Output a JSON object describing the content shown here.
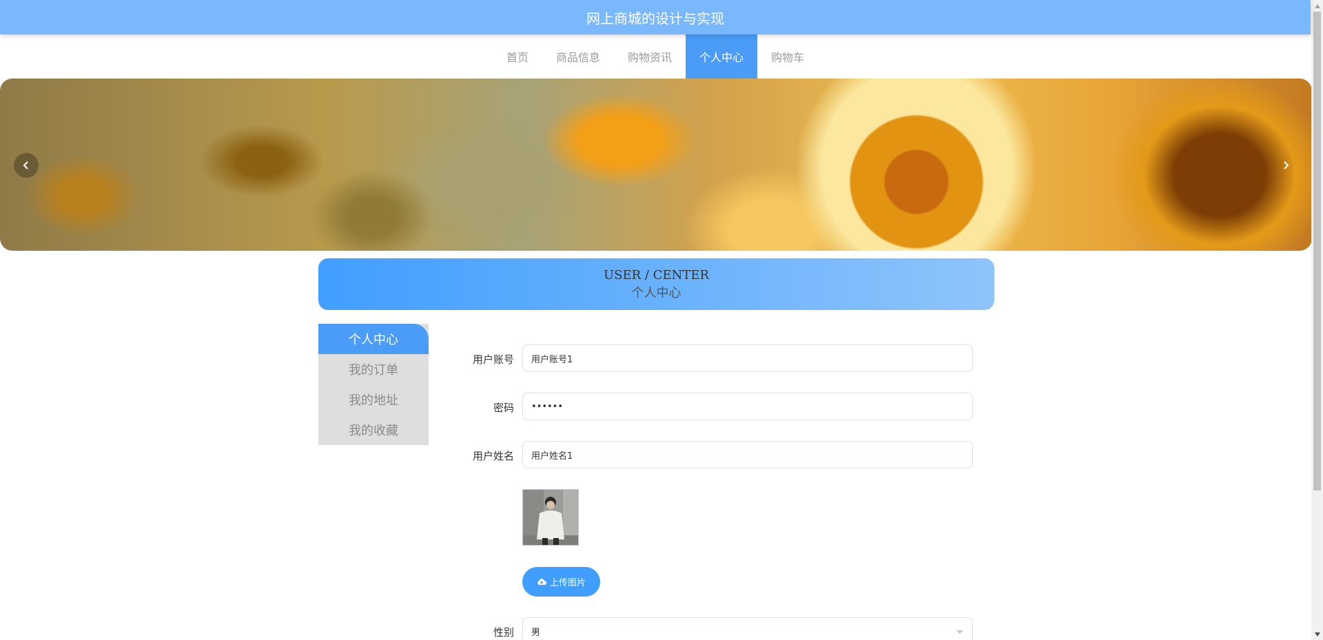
{
  "app": {
    "title": "网上商城的设计与实现"
  },
  "nav": {
    "items": [
      {
        "label": "首页"
      },
      {
        "label": "商品信息"
      },
      {
        "label": "购物资讯"
      },
      {
        "label": "个人中心",
        "active": true
      },
      {
        "label": "购物车"
      }
    ]
  },
  "banner": {
    "prev_icon": "chevron-left-icon",
    "next_icon": "chevron-right-icon"
  },
  "section_header": {
    "en": "USER / CENTER",
    "cn": "个人中心"
  },
  "side_menu": {
    "items": [
      {
        "label": "个人中心",
        "active": true
      },
      {
        "label": "我的订单"
      },
      {
        "label": "我的地址"
      },
      {
        "label": "我的收藏"
      }
    ]
  },
  "form": {
    "account": {
      "label": "用户账号",
      "value": "用户账号1"
    },
    "password": {
      "label": "密码",
      "value": "••••••"
    },
    "name": {
      "label": "用户姓名",
      "value": "用户姓名1"
    },
    "upload": {
      "label": "上传图片",
      "icon": "upload-cloud-icon"
    },
    "gender": {
      "label": "性别",
      "value": "男"
    }
  },
  "colors": {
    "primary": "#409efe",
    "topbar": "#7ab8fd",
    "nav_active": "#4a9cf7",
    "side_bg": "#dedede"
  }
}
